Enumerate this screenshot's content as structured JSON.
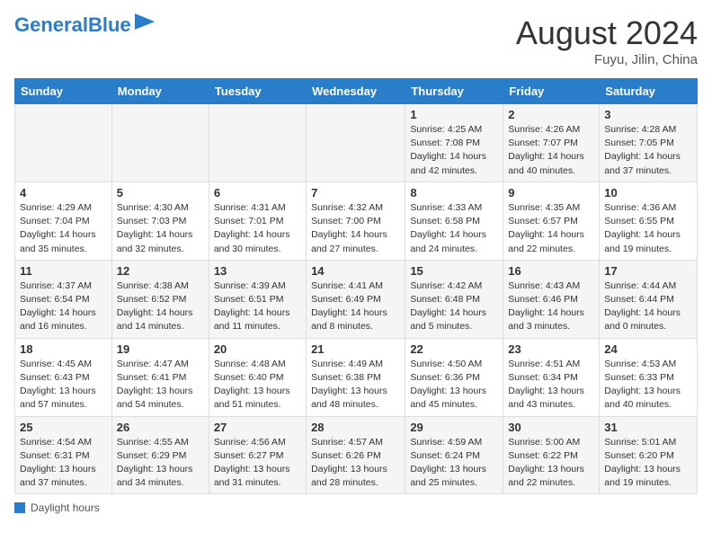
{
  "header": {
    "logo_general": "General",
    "logo_blue": "Blue",
    "month_year": "August 2024",
    "location": "Fuyu, Jilin, China"
  },
  "days_of_week": [
    "Sunday",
    "Monday",
    "Tuesday",
    "Wednesday",
    "Thursday",
    "Friday",
    "Saturday"
  ],
  "weeks": [
    [
      {
        "num": "",
        "info": ""
      },
      {
        "num": "",
        "info": ""
      },
      {
        "num": "",
        "info": ""
      },
      {
        "num": "",
        "info": ""
      },
      {
        "num": "1",
        "info": "Sunrise: 4:25 AM\nSunset: 7:08 PM\nDaylight: 14 hours and 42 minutes."
      },
      {
        "num": "2",
        "info": "Sunrise: 4:26 AM\nSunset: 7:07 PM\nDaylight: 14 hours and 40 minutes."
      },
      {
        "num": "3",
        "info": "Sunrise: 4:28 AM\nSunset: 7:05 PM\nDaylight: 14 hours and 37 minutes."
      }
    ],
    [
      {
        "num": "4",
        "info": "Sunrise: 4:29 AM\nSunset: 7:04 PM\nDaylight: 14 hours and 35 minutes."
      },
      {
        "num": "5",
        "info": "Sunrise: 4:30 AM\nSunset: 7:03 PM\nDaylight: 14 hours and 32 minutes."
      },
      {
        "num": "6",
        "info": "Sunrise: 4:31 AM\nSunset: 7:01 PM\nDaylight: 14 hours and 30 minutes."
      },
      {
        "num": "7",
        "info": "Sunrise: 4:32 AM\nSunset: 7:00 PM\nDaylight: 14 hours and 27 minutes."
      },
      {
        "num": "8",
        "info": "Sunrise: 4:33 AM\nSunset: 6:58 PM\nDaylight: 14 hours and 24 minutes."
      },
      {
        "num": "9",
        "info": "Sunrise: 4:35 AM\nSunset: 6:57 PM\nDaylight: 14 hours and 22 minutes."
      },
      {
        "num": "10",
        "info": "Sunrise: 4:36 AM\nSunset: 6:55 PM\nDaylight: 14 hours and 19 minutes."
      }
    ],
    [
      {
        "num": "11",
        "info": "Sunrise: 4:37 AM\nSunset: 6:54 PM\nDaylight: 14 hours and 16 minutes."
      },
      {
        "num": "12",
        "info": "Sunrise: 4:38 AM\nSunset: 6:52 PM\nDaylight: 14 hours and 14 minutes."
      },
      {
        "num": "13",
        "info": "Sunrise: 4:39 AM\nSunset: 6:51 PM\nDaylight: 14 hours and 11 minutes."
      },
      {
        "num": "14",
        "info": "Sunrise: 4:41 AM\nSunset: 6:49 PM\nDaylight: 14 hours and 8 minutes."
      },
      {
        "num": "15",
        "info": "Sunrise: 4:42 AM\nSunset: 6:48 PM\nDaylight: 14 hours and 5 minutes."
      },
      {
        "num": "16",
        "info": "Sunrise: 4:43 AM\nSunset: 6:46 PM\nDaylight: 14 hours and 3 minutes."
      },
      {
        "num": "17",
        "info": "Sunrise: 4:44 AM\nSunset: 6:44 PM\nDaylight: 14 hours and 0 minutes."
      }
    ],
    [
      {
        "num": "18",
        "info": "Sunrise: 4:45 AM\nSunset: 6:43 PM\nDaylight: 13 hours and 57 minutes."
      },
      {
        "num": "19",
        "info": "Sunrise: 4:47 AM\nSunset: 6:41 PM\nDaylight: 13 hours and 54 minutes."
      },
      {
        "num": "20",
        "info": "Sunrise: 4:48 AM\nSunset: 6:40 PM\nDaylight: 13 hours and 51 minutes."
      },
      {
        "num": "21",
        "info": "Sunrise: 4:49 AM\nSunset: 6:38 PM\nDaylight: 13 hours and 48 minutes."
      },
      {
        "num": "22",
        "info": "Sunrise: 4:50 AM\nSunset: 6:36 PM\nDaylight: 13 hours and 45 minutes."
      },
      {
        "num": "23",
        "info": "Sunrise: 4:51 AM\nSunset: 6:34 PM\nDaylight: 13 hours and 43 minutes."
      },
      {
        "num": "24",
        "info": "Sunrise: 4:53 AM\nSunset: 6:33 PM\nDaylight: 13 hours and 40 minutes."
      }
    ],
    [
      {
        "num": "25",
        "info": "Sunrise: 4:54 AM\nSunset: 6:31 PM\nDaylight: 13 hours and 37 minutes."
      },
      {
        "num": "26",
        "info": "Sunrise: 4:55 AM\nSunset: 6:29 PM\nDaylight: 13 hours and 34 minutes."
      },
      {
        "num": "27",
        "info": "Sunrise: 4:56 AM\nSunset: 6:27 PM\nDaylight: 13 hours and 31 minutes."
      },
      {
        "num": "28",
        "info": "Sunrise: 4:57 AM\nSunset: 6:26 PM\nDaylight: 13 hours and 28 minutes."
      },
      {
        "num": "29",
        "info": "Sunrise: 4:59 AM\nSunset: 6:24 PM\nDaylight: 13 hours and 25 minutes."
      },
      {
        "num": "30",
        "info": "Sunrise: 5:00 AM\nSunset: 6:22 PM\nDaylight: 13 hours and 22 minutes."
      },
      {
        "num": "31",
        "info": "Sunrise: 5:01 AM\nSunset: 6:20 PM\nDaylight: 13 hours and 19 minutes."
      }
    ]
  ],
  "footer": {
    "label": "Daylight hours"
  },
  "colors": {
    "header_bg": "#2a7dc9",
    "logo_blue": "#2a7dc9"
  }
}
